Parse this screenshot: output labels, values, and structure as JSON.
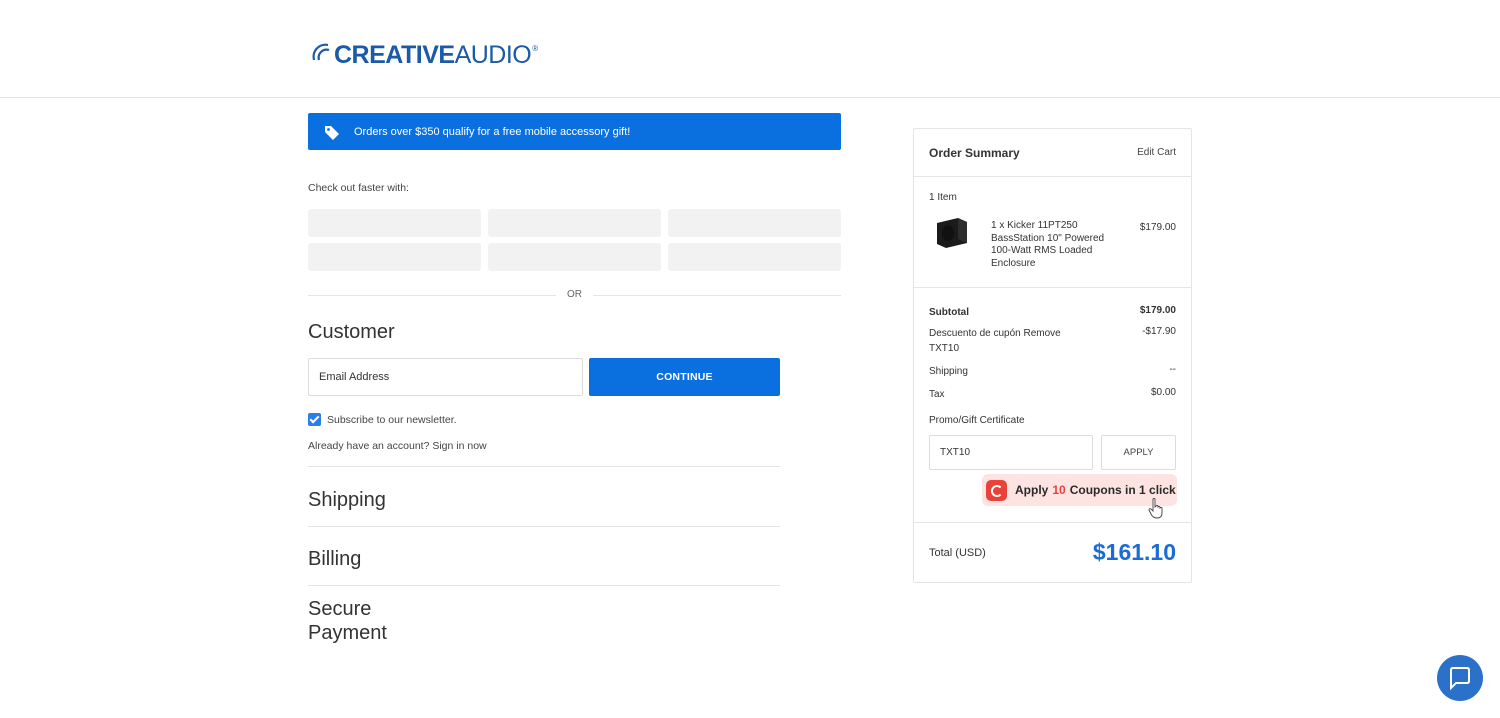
{
  "brand": {
    "part1": "CREATIVE",
    "part2": "AUDIO",
    "reg": "®"
  },
  "promo_banner": {
    "text": "Orders over $350 qualify for a free mobile accessory gift!",
    "icon": "tag-icon"
  },
  "checkout_faster": "Check out faster with:",
  "or_text": "OR",
  "customer": {
    "title": "Customer",
    "email_placeholder": "Email Address",
    "continue_label": "CONTINUE",
    "subscribe_label": "Subscribe to our newsletter.",
    "subscribed": true,
    "signin_text": "Already have an account? Sign in now"
  },
  "steps": {
    "shipping": "Shipping",
    "billing": "Billing",
    "payment": "Secure Payment"
  },
  "summary": {
    "title": "Order Summary",
    "edit_cart": "Edit Cart",
    "items_count": "1 Item",
    "product": {
      "name": "1 x Kicker 11PT250 BassStation 10\" Powered 100-Watt RMS Loaded Enclosure",
      "price": "$179.00"
    },
    "subtotal": {
      "label": "Subtotal",
      "value": "$179.00"
    },
    "discount": {
      "label": "Descuento de cupón Remove TXT10",
      "value": "-$17.90"
    },
    "shipping": {
      "label": "Shipping",
      "value": "--"
    },
    "tax": {
      "label": "Tax",
      "value": "$0.00"
    },
    "promo_label": "Promo/Gift Certificate",
    "promo_value": "TXT10",
    "apply_label": "APPLY",
    "coupon": {
      "prefix": "Apply",
      "count": "10",
      "suffix": "Coupons in 1 click"
    },
    "total_label": "Total (USD)",
    "total_value": "$161.10"
  },
  "colors": {
    "primary": "#0a70e0",
    "total": "#1a6bd6",
    "coupon_accent": "#e8423a"
  }
}
